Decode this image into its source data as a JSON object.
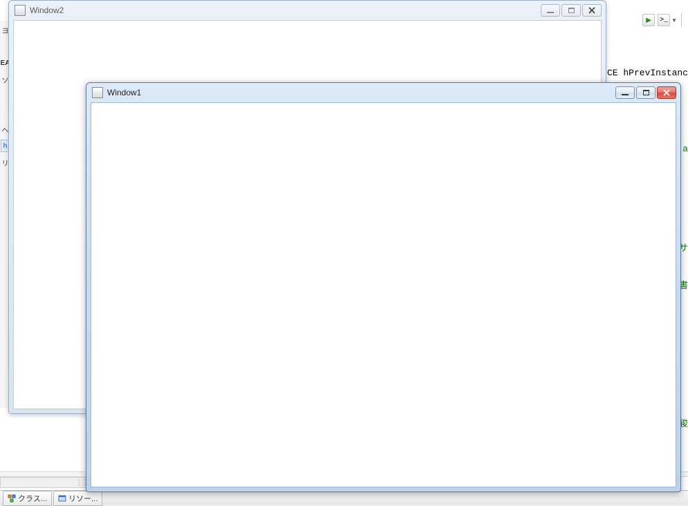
{
  "windows": {
    "back": {
      "title": "Window2"
    },
    "front": {
      "title": "Window1"
    }
  },
  "ide": {
    "code_fragment": "TANCE hPrevInstanc",
    "left_items": [
      "ヨ",
      "",
      "EA",
      "ソ",
      "",
      "",
      "ヘ",
      "h",
      "リ"
    ],
    "green_fragments": [
      "a",
      "サ",
      "書",
      "狻"
    ],
    "tabs": {
      "class_view": "クラス...",
      "resource": "リソー..."
    }
  }
}
